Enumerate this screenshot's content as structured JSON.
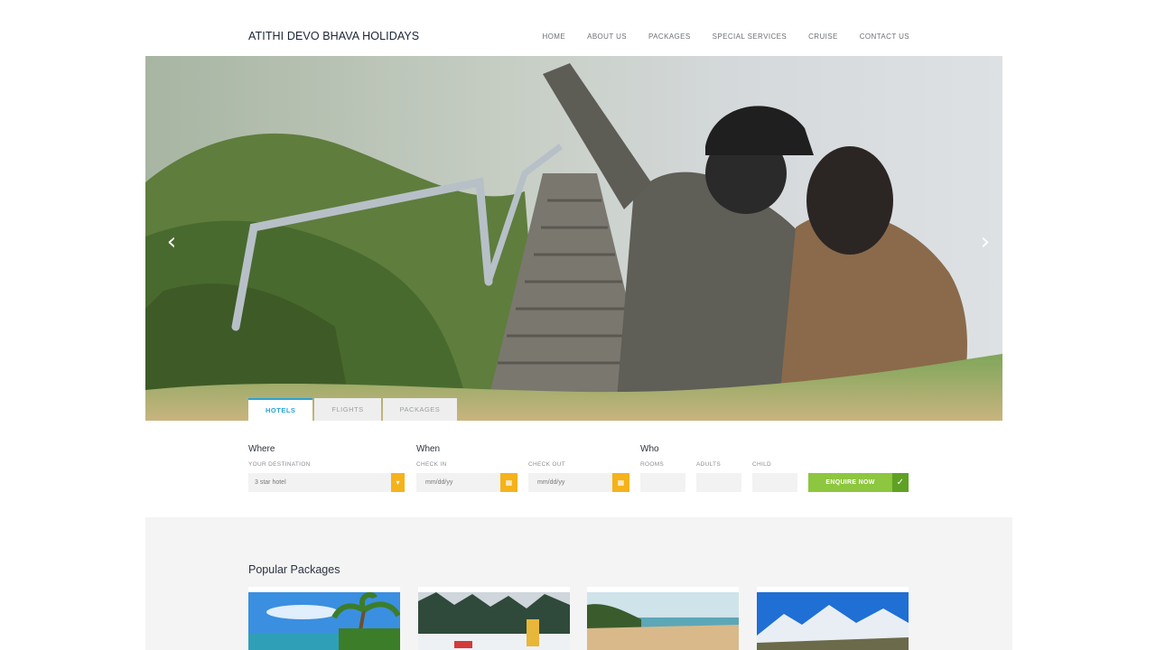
{
  "header": {
    "brand": "ATITHI DEVO BHAVA HOLIDAYS",
    "nav": [
      "HOME",
      "ABOUT US",
      "PACKAGES",
      "SPECIAL SERVICES",
      "CRUISE",
      "CONTACT US"
    ]
  },
  "hero": {
    "prev_icon": "chevron-left-icon",
    "next_icon": "chevron-right-icon"
  },
  "tabs": [
    "HOTELS",
    "FLIGHTS",
    "PACKAGES"
  ],
  "search": {
    "where": {
      "heading": "Where",
      "label": "YOUR DESTINATION",
      "value": "3 star hotel"
    },
    "when": {
      "heading": "When",
      "checkin_label": "CHECK IN",
      "checkin_placeholder": "mm/dd/yy",
      "checkout_label": "CHECK OUT",
      "checkout_placeholder": "mm/dd/yy"
    },
    "who": {
      "heading": "Who",
      "rooms_label": "ROOMS",
      "adults_label": "ADULTS",
      "child_label": "CHILD"
    },
    "enquire_label": "ENQUIRE NOW"
  },
  "packages": {
    "title": "Popular Packages"
  },
  "colors": {
    "accent_blue": "#2aa2d6",
    "accent_yellow": "#f5b21b",
    "accent_green": "#8dc63f"
  }
}
